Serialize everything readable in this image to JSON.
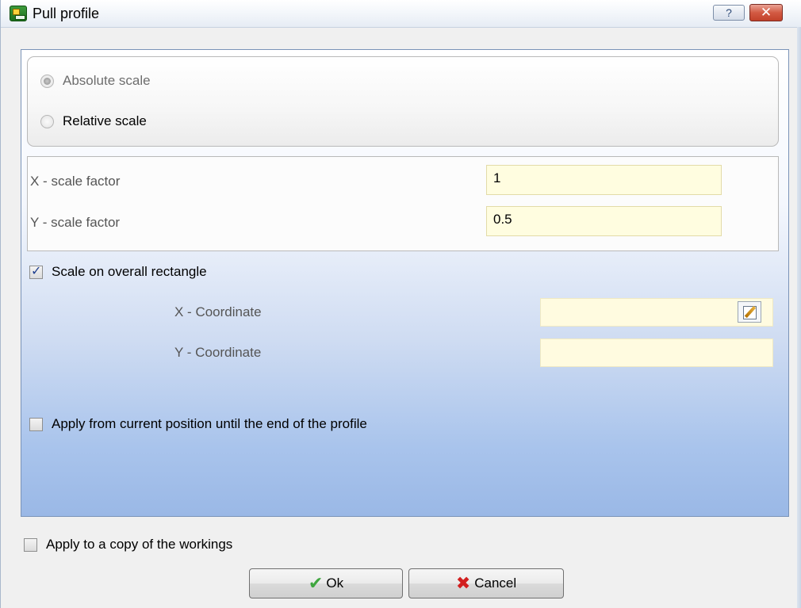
{
  "window": {
    "title": "Pull profile",
    "help_label": "?",
    "close_label": "✕"
  },
  "scale_mode": {
    "options": [
      {
        "label": "Absolute scale",
        "selected": true
      },
      {
        "label": "Relative scale",
        "selected": false
      }
    ]
  },
  "factors": {
    "x_label": "X - scale factor",
    "x_value": "1",
    "y_label": "Y - scale factor",
    "y_value": "0.5"
  },
  "overall_rectangle": {
    "label": "Scale on overall rectangle",
    "checked": true,
    "x_coord_label": "X - Coordinate",
    "x_coord_value": "",
    "y_coord_label": "Y - Coordinate",
    "y_coord_value": ""
  },
  "apply_from_current": {
    "label": "Apply from current position until the end of the profile",
    "checked": false
  },
  "apply_copy": {
    "label": "Apply to a copy of the workings",
    "checked": false
  },
  "buttons": {
    "ok_label": "Ok",
    "cancel_label": "Cancel"
  },
  "icons": {
    "app": "app-icon",
    "help": "help-icon",
    "close": "close-icon",
    "picker": "edit-picker-icon",
    "ok": "checkmark-icon",
    "cancel": "red-x-icon"
  },
  "colors": {
    "panel_gradient_bottom": "#9ab8e6",
    "input_background": "#fffde0",
    "close_button": "#c2412a"
  }
}
